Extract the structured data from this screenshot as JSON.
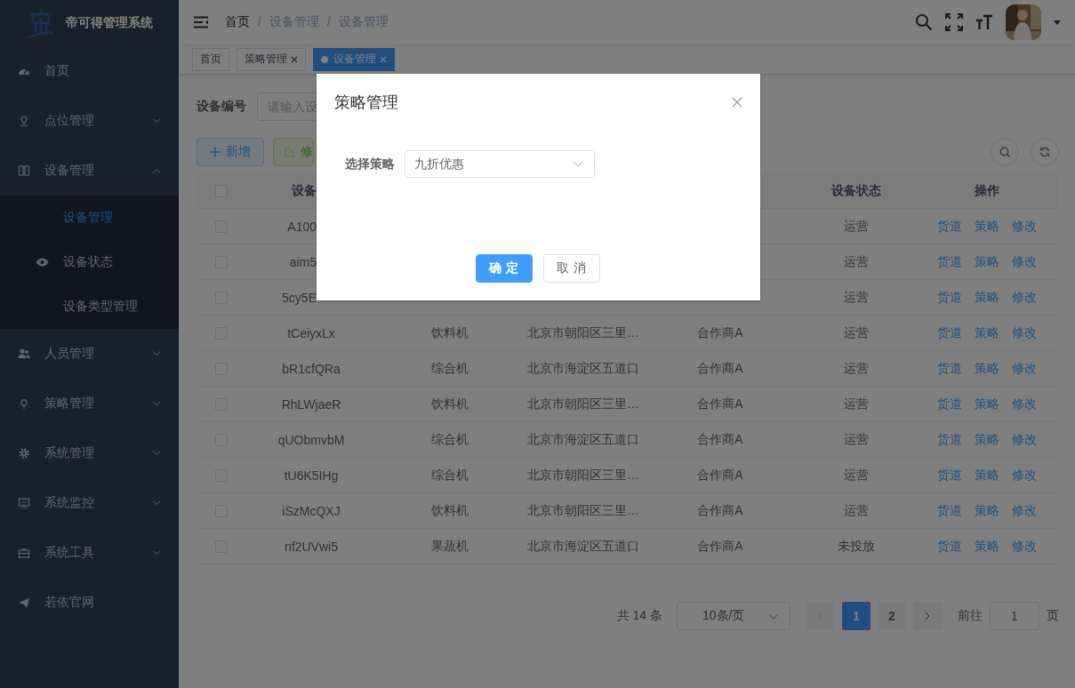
{
  "sidebar": {
    "logo_text": "帝可得管理系统",
    "items": [
      {
        "label": "首页",
        "kind": "link"
      },
      {
        "label": "点位管理",
        "kind": "submenu",
        "expanded": false
      },
      {
        "label": "设备管理",
        "kind": "submenu",
        "expanded": true,
        "children": [
          {
            "label": "设备管理",
            "selected": true,
            "icon": false
          },
          {
            "label": "设备状态",
            "selected": false,
            "icon": true
          },
          {
            "label": "设备类型管理",
            "selected": false,
            "icon": false
          }
        ]
      },
      {
        "label": "人员管理",
        "kind": "submenu",
        "expanded": false
      },
      {
        "label": "策略管理",
        "kind": "submenu",
        "expanded": false
      },
      {
        "label": "系统管理",
        "kind": "submenu",
        "expanded": false
      },
      {
        "label": "系统监控",
        "kind": "submenu",
        "expanded": false
      },
      {
        "label": "系统工具",
        "kind": "submenu",
        "expanded": false
      },
      {
        "label": "若依官网",
        "kind": "link"
      }
    ]
  },
  "navbar": {
    "breadcrumb": [
      {
        "kind": "link",
        "label": "首页"
      },
      {
        "kind": "separator",
        "label": "/"
      },
      {
        "kind": "link",
        "label": "设备管理"
      },
      {
        "kind": "separator",
        "label": "/"
      },
      {
        "kind": "current",
        "label": "设备管理"
      }
    ]
  },
  "tags": [
    {
      "label": "首页",
      "selected": false,
      "closable": false
    },
    {
      "label": "策略管理",
      "selected": false,
      "closable": true
    },
    {
      "label": "设备管理",
      "selected": true,
      "closable": true
    }
  ],
  "search_form": {
    "label": "设备编号",
    "placeholder": "请输入设"
  },
  "toolbar": [
    {
      "label": "新增",
      "kind": "primary"
    },
    {
      "label": "修",
      "kind": "success"
    }
  ],
  "table": {
    "columns": [
      {
        "kind": "checkbox",
        "checked": false
      },
      {
        "kind": "text",
        "label": "设备"
      },
      {
        "kind": "covered"
      },
      {
        "kind": "covered"
      },
      {
        "kind": "covered"
      },
      {
        "kind": "text",
        "label": "设备状态"
      },
      {
        "kind": "text",
        "label": "操作"
      }
    ],
    "rows": [
      {
        "checked": false,
        "id": "A100",
        "status": "运营",
        "actions": [
          "货道",
          "策略",
          "修改"
        ]
      },
      {
        "checked": false,
        "id": "aim5",
        "status": "运营",
        "actions": [
          "货道",
          "策略",
          "修改"
        ]
      },
      {
        "checked": false,
        "id": "5cy5E",
        "status": "运营",
        "actions": [
          "货道",
          "策略",
          "修改"
        ]
      },
      {
        "checked": false,
        "id": "tCeiyxLx",
        "type": "饮料机",
        "address": "北京市朝阳区三里…",
        "partner": "合作商A",
        "status": "运营",
        "actions": [
          "货道",
          "策略",
          "修改"
        ]
      },
      {
        "checked": false,
        "id": "bR1cfQRa",
        "type": "综合机",
        "address": "北京市海淀区五道口",
        "partner": "合作商A",
        "status": "运营",
        "actions": [
          "货道",
          "策略",
          "修改"
        ]
      },
      {
        "checked": false,
        "id": "RhLWjaeR",
        "type": "饮料机",
        "address": "北京市朝阳区三里…",
        "partner": "合作商A",
        "status": "运营",
        "actions": [
          "货道",
          "策略",
          "修改"
        ]
      },
      {
        "checked": false,
        "id": "qUObmvbM",
        "type": "综合机",
        "address": "北京市海淀区五道口",
        "partner": "合作商A",
        "status": "运营",
        "actions": [
          "货道",
          "策略",
          "修改"
        ]
      },
      {
        "checked": false,
        "id": "tU6K5IHg",
        "type": "综合机",
        "address": "北京市朝阳区三里…",
        "partner": "合作商A",
        "status": "运营",
        "actions": [
          "货道",
          "策略",
          "修改"
        ]
      },
      {
        "checked": false,
        "id": "iSzMcQXJ",
        "type": "饮料机",
        "address": "北京市朝阳区三里…",
        "partner": "合作商A",
        "status": "运营",
        "actions": [
          "货道",
          "策略",
          "修改"
        ]
      },
      {
        "checked": false,
        "id": "nf2UVwi5",
        "type": "果蔬机",
        "address": "北京市海淀区五道口",
        "partner": "合作商A",
        "status": "未投放",
        "actions": [
          "货道",
          "策略",
          "修改"
        ]
      }
    ]
  },
  "pagination": {
    "total": "共 14 条",
    "page_size": "10条/页",
    "pages": [
      {
        "label": "1",
        "selected": true
      },
      {
        "label": "2",
        "selected": false
      }
    ],
    "goto_label": "前往",
    "goto_value": "1",
    "goto_suffix": "页"
  },
  "dialog": {
    "title": "策略管理",
    "field_label": "选择策略",
    "field_value": "九折优惠",
    "buttons": [
      {
        "label": "确 定",
        "kind": "primary"
      },
      {
        "label": "取 消",
        "kind": "default"
      }
    ]
  }
}
